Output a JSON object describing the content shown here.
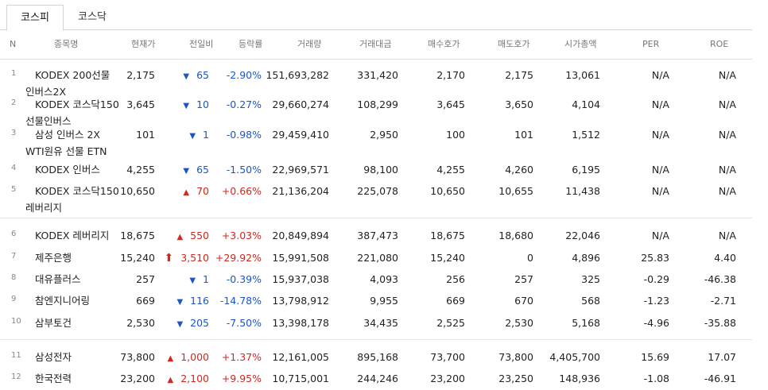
{
  "tabs": [
    {
      "label": "코스피",
      "active": true
    },
    {
      "label": "코스닥",
      "active": false
    }
  ],
  "columns": [
    "N",
    "종목명",
    "현재가",
    "전일비",
    "등락률",
    "거래량",
    "거래대금",
    "매수호가",
    "매도호가",
    "시가총액",
    "PER",
    "ROE"
  ],
  "colors": {
    "up": "#d3271f",
    "down": "#1a56c8"
  },
  "rows": [
    {
      "n": "1",
      "name": "KODEX 200선물\n인버스2X",
      "price": "2,175",
      "dir": "down",
      "icon": "down-triangle",
      "change": "65",
      "rate": "-2.90%",
      "volume": "151,693,282",
      "amount": "331,420",
      "bid": "2,170",
      "ask": "2,175",
      "mcap": "13,061",
      "per": "N/A",
      "roe": "N/A"
    },
    {
      "n": "2",
      "name": "KODEX 코스닥150\n선물인버스",
      "price": "3,645",
      "dir": "down",
      "icon": "down-triangle",
      "change": "10",
      "rate": "-0.27%",
      "volume": "29,660,274",
      "amount": "108,299",
      "bid": "3,645",
      "ask": "3,650",
      "mcap": "4,104",
      "per": "N/A",
      "roe": "N/A"
    },
    {
      "n": "3",
      "name": "삼성 인버스 2X\nWTI원유 선물 ETN",
      "price": "101",
      "dir": "down",
      "icon": "down-triangle",
      "change": "1",
      "rate": "-0.98%",
      "volume": "29,459,410",
      "amount": "2,950",
      "bid": "100",
      "ask": "101",
      "mcap": "1,512",
      "per": "N/A",
      "roe": "N/A"
    },
    {
      "n": "4",
      "name": "KODEX 인버스",
      "price": "4,255",
      "dir": "down",
      "icon": "down-triangle",
      "change": "65",
      "rate": "-1.50%",
      "volume": "22,969,571",
      "amount": "98,100",
      "bid": "4,255",
      "ask": "4,260",
      "mcap": "6,195",
      "per": "N/A",
      "roe": "N/A"
    },
    {
      "n": "5",
      "name": "KODEX 코스닥150\n레버리지",
      "price": "10,650",
      "dir": "up",
      "icon": "up-triangle",
      "change": "70",
      "rate": "+0.66%",
      "volume": "21,136,204",
      "amount": "225,078",
      "bid": "10,650",
      "ask": "10,655",
      "mcap": "11,438",
      "per": "N/A",
      "roe": "N/A"
    },
    {
      "n": "6",
      "name": "KODEX 레버리지",
      "price": "18,675",
      "dir": "up",
      "icon": "up-triangle",
      "change": "550",
      "rate": "+3.03%",
      "volume": "20,849,894",
      "amount": "387,473",
      "bid": "18,675",
      "ask": "18,680",
      "mcap": "22,046",
      "per": "N/A",
      "roe": "N/A"
    },
    {
      "n": "7",
      "name": "제주은행",
      "price": "15,240",
      "dir": "up",
      "icon": "upper-limit-arrow",
      "change": "3,510",
      "rate": "+29.92%",
      "volume": "15,991,508",
      "amount": "221,080",
      "bid": "15,240",
      "ask": "0",
      "mcap": "4,896",
      "per": "25.83",
      "roe": "4.40"
    },
    {
      "n": "8",
      "name": "대유플러스",
      "price": "257",
      "dir": "down",
      "icon": "down-triangle",
      "change": "1",
      "rate": "-0.39%",
      "volume": "15,937,038",
      "amount": "4,093",
      "bid": "256",
      "ask": "257",
      "mcap": "325",
      "per": "-0.29",
      "roe": "-46.38"
    },
    {
      "n": "9",
      "name": "참엔지니어링",
      "price": "669",
      "dir": "down",
      "icon": "down-triangle",
      "change": "116",
      "rate": "-14.78%",
      "volume": "13,798,912",
      "amount": "9,955",
      "bid": "669",
      "ask": "670",
      "mcap": "568",
      "per": "-1.23",
      "roe": "-2.71"
    },
    {
      "n": "10",
      "name": "삼부토건",
      "price": "2,530",
      "dir": "down",
      "icon": "down-triangle",
      "change": "205",
      "rate": "-7.50%",
      "volume": "13,398,178",
      "amount": "34,435",
      "bid": "2,525",
      "ask": "2,530",
      "mcap": "5,168",
      "per": "-4.96",
      "roe": "-35.88"
    },
    {
      "n": "11",
      "name": "삼성전자",
      "price": "73,800",
      "dir": "up",
      "icon": "up-triangle",
      "change": "1,000",
      "rate": "+1.37%",
      "volume": "12,161,005",
      "amount": "895,168",
      "bid": "73,700",
      "ask": "73,800",
      "mcap": "4,405,700",
      "per": "15.69",
      "roe": "17.07"
    },
    {
      "n": "12",
      "name": "한국전력",
      "price": "23,200",
      "dir": "up",
      "icon": "up-triangle",
      "change": "2,100",
      "rate": "+9.95%",
      "volume": "10,715,001",
      "amount": "244,246",
      "bid": "23,200",
      "ask": "23,250",
      "mcap": "148,936",
      "per": "-1.08",
      "roe": "-46.91"
    }
  ]
}
